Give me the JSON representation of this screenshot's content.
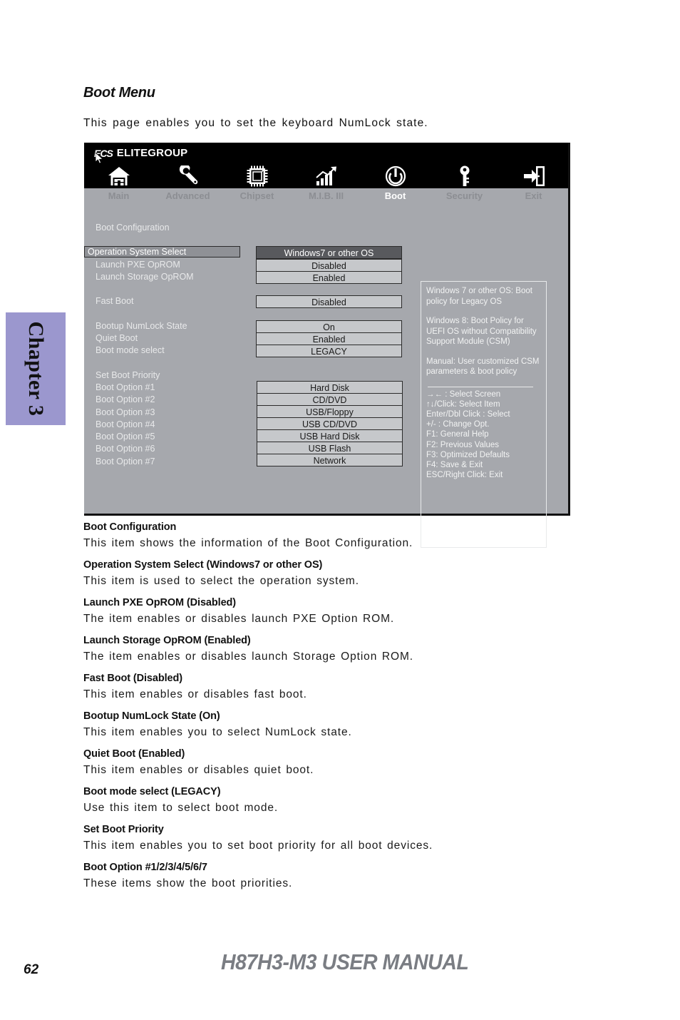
{
  "chapter_tab": {
    "label": "Chapter 3"
  },
  "document": {
    "heading": "Boot Menu",
    "intro": "This page enables you to set the keyboard NumLock state."
  },
  "bios": {
    "brand_mark": "ECS",
    "brand_name": "ELITEGROUP",
    "nav": [
      {
        "label": "Main",
        "icon": "home-icon",
        "active": false
      },
      {
        "label": "Advanced",
        "icon": "wrench-icon",
        "active": false
      },
      {
        "label": "Chipset",
        "icon": "chip-icon",
        "active": false
      },
      {
        "label": "M.I.B. III",
        "icon": "chart-icon",
        "active": false
      },
      {
        "label": "Boot",
        "icon": "power-icon",
        "active": true
      },
      {
        "label": "Security",
        "icon": "key-icon",
        "active": false
      },
      {
        "label": "Exit",
        "icon": "exit-door-icon",
        "active": false
      }
    ],
    "section_boot_config": "Boot Configuration",
    "section_set_priority": "Set Boot Priority",
    "settings": [
      {
        "label": "Operation System Select",
        "value": "Windows7 or other OS",
        "highlighted": true
      },
      {
        "label": "Launch PXE OpROM",
        "value": "Disabled",
        "highlighted": false
      },
      {
        "label": "Launch Storage OpROM",
        "value": "Enabled",
        "highlighted": false
      },
      {
        "label": "Fast Boot",
        "value": "Disabled",
        "highlighted": false
      },
      {
        "label": "Bootup NumLock State",
        "value": "On",
        "highlighted": false
      },
      {
        "label": "Quiet Boot",
        "value": "Enabled",
        "highlighted": false
      },
      {
        "label": "Boot  mode select",
        "value": "LEGACY",
        "highlighted": false
      }
    ],
    "boot_options": [
      {
        "label": "Boot Option #1",
        "value": "Hard Disk"
      },
      {
        "label": "Boot Option #2",
        "value": "CD/DVD"
      },
      {
        "label": "Boot Option #3",
        "value": "USB/Floppy"
      },
      {
        "label": "Boot Option #4",
        "value": "USB CD/DVD"
      },
      {
        "label": "Boot Option #5",
        "value": "USB Hard Disk"
      },
      {
        "label": "Boot Option #6",
        "value": "USB Flash"
      },
      {
        "label": "Boot Option #7",
        "value": "Network"
      }
    ],
    "help": {
      "paragraphs": [
        "Windows 7 or other OS: Boot policy for Legacy OS",
        "Windows 8: Boot Policy for UEFI OS without Compatibility Support Module (CSM)",
        "Manual: User customized CSM parameters & boot policy"
      ],
      "keys": [
        "→←   : Select Screen",
        "↑↓/Click: Select Item",
        "Enter/Dbl Click : Select",
        "+/- : Change Opt.",
        "F1: General Help",
        "F2: Previous Values",
        "F3: Optimized Defaults",
        "F4: Save & Exit",
        "ESC/Right Click: Exit"
      ]
    }
  },
  "descriptions": [
    {
      "term": "Boot Configuration",
      "definition": "This item shows the information of the Boot Configuration."
    },
    {
      "term": "Operation System Select (Windows7 or other OS)",
      "definition": "This item is used to select the operation system."
    },
    {
      "term": "Launch PXE OpROM (Disabled)",
      "definition": "The item enables or disables launch PXE Option ROM."
    },
    {
      "term": "Launch Storage OpROM (Enabled)",
      "definition": "The item enables or disables launch Storage Option ROM."
    },
    {
      "term": "Fast Boot (Disabled)",
      "definition": "This item enables or disables fast boot."
    },
    {
      "term": "Bootup NumLock State (On)",
      "definition": "This item enables you to select NumLock state."
    },
    {
      "term": "Quiet Boot (Enabled)",
      "definition": "This item enables or disables quiet boot."
    },
    {
      "term": "Boot mode select (LEGACY)",
      "definition": "Use this item to select boot mode."
    },
    {
      "term": "Set Boot Priority",
      "definition": "This item enables you to set boot priority for all boot devices."
    },
    {
      "term": "Boot Option #1/2/3/4/5/6/7",
      "definition": "These items show the boot priorities."
    }
  ],
  "footer": {
    "page_number": "62",
    "manual_title": "H87H3-M3 USER MANUAL"
  }
}
